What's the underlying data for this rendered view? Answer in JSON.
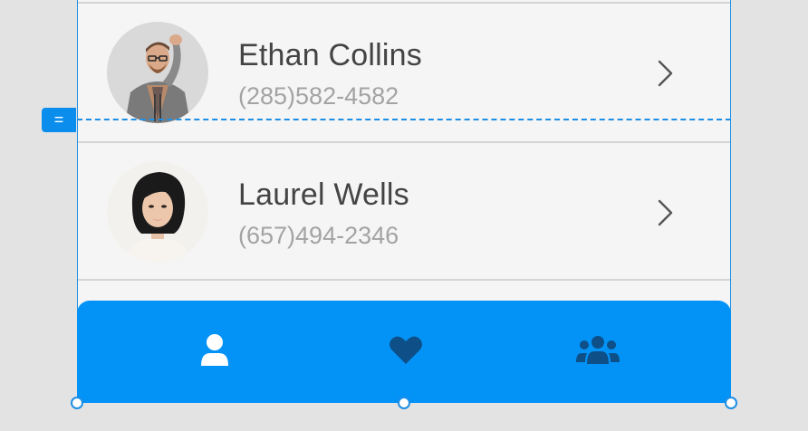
{
  "contacts": [
    {
      "name": "Ethan Collins",
      "phone": "(285)582-4582",
      "avatar_icon": "person-photo-icon"
    },
    {
      "name": "Laurel Wells",
      "phone": "(657)494-2346",
      "avatar_icon": "person-photo-icon"
    }
  ],
  "guide_handle": {
    "label": "="
  },
  "tabbar": {
    "tabs": [
      {
        "icon": "user-icon"
      },
      {
        "icon": "heart-icon"
      },
      {
        "icon": "users-icon"
      }
    ]
  },
  "colors": {
    "accent": "#0393f7",
    "selection": "#1e8fe6",
    "row_bg": "#f5f5f5",
    "name_text": "#444444",
    "phone_text": "#a3a3a3",
    "tab_icon_active": "#ffffff",
    "tab_icon_inactive": "#0d4f86"
  }
}
